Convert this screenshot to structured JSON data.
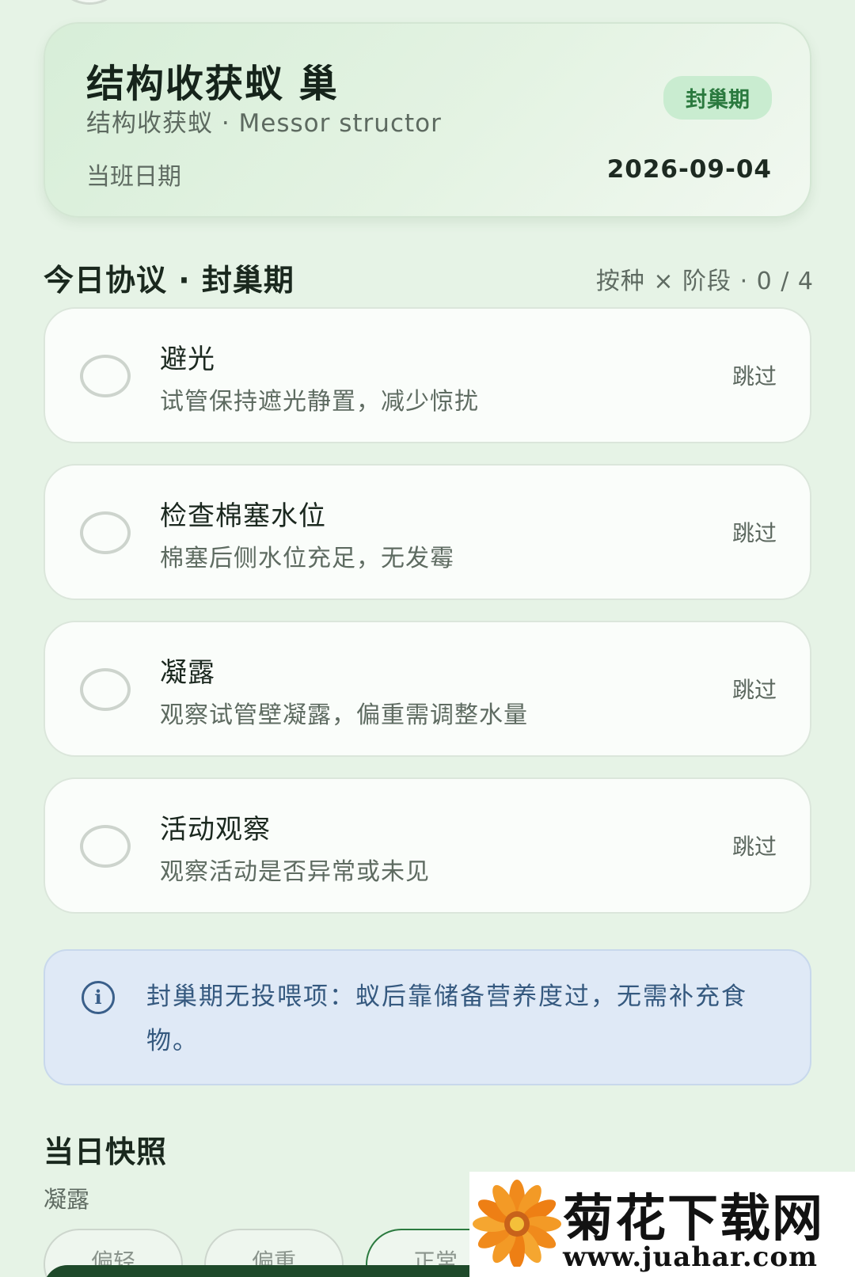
{
  "header": {
    "title": "结构收获蚁 巢",
    "subtitle": "结构收获蚁 · Messor structor",
    "stage_badge": "封巢期",
    "duty_label": "当班日期",
    "duty_date": "2026-09-04"
  },
  "protocol": {
    "heading": "今日协议 · 封巢期",
    "meta": "按种 × 阶段 · 0 / 4",
    "tasks": [
      {
        "title": "避光",
        "description": "试管保持遮光静置，减少惊扰",
        "skip_label": "跳过"
      },
      {
        "title": "检查棉塞水位",
        "description": "棉塞后侧水位充足，无发霉",
        "skip_label": "跳过"
      },
      {
        "title": "凝露",
        "description": "观察试管壁凝露，偏重需调整水量",
        "skip_label": "跳过"
      },
      {
        "title": "活动观察",
        "description": "观察活动是否异常或未见",
        "skip_label": "跳过"
      }
    ]
  },
  "notice": {
    "icon": "info-icon",
    "text": "封巢期无投喂项：蚁后靠储备营养度过，无需补充食物。"
  },
  "snapshot": {
    "heading": "当日快照",
    "field_label": "凝露",
    "options": [
      "偏轻",
      "偏重",
      "正常"
    ]
  },
  "watermark": {
    "title": "菊花下载网",
    "url": "www.juahar.com"
  },
  "colors": {
    "background": "#e6f3e6",
    "badge_bg": "#c9ecd0",
    "badge_text": "#2b7a3f",
    "notice_bg": "#dfe9f6",
    "notice_text": "#35597f",
    "primary_dark": "#1e4a2a"
  }
}
